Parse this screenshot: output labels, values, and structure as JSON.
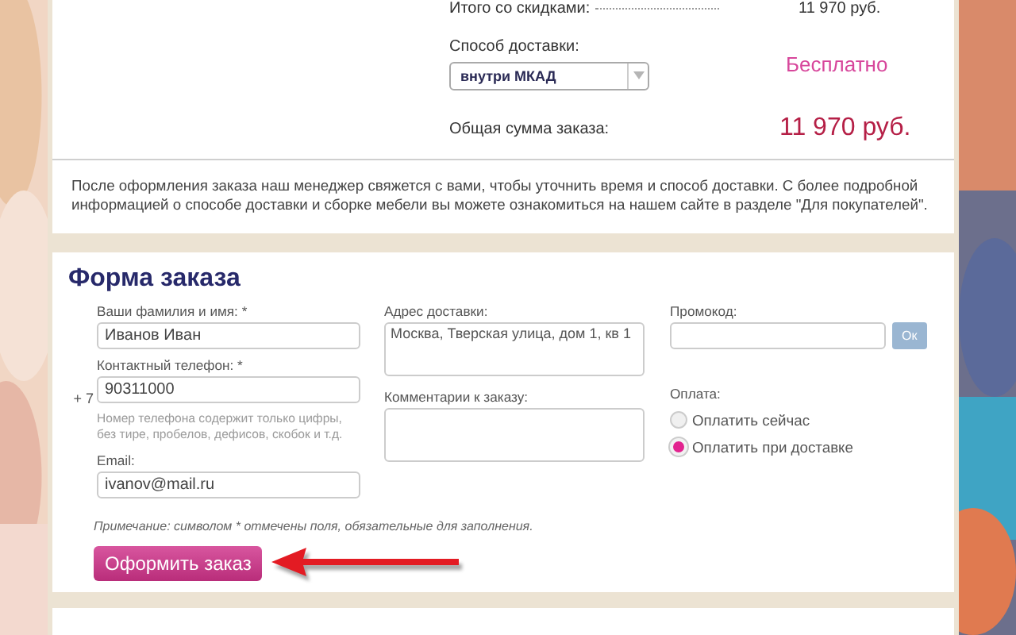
{
  "summary": {
    "discount_label": "Итого со скидками:",
    "discount_total": "11 970 руб.",
    "delivery_label": "Способ доставки:",
    "delivery_method": "внутри МКАД",
    "delivery_price": "Бесплатно",
    "total_label": "Общая сумма заказа:",
    "total": "11 970 руб."
  },
  "info": "После оформления заказа наш менеджер свяжется с вами, чтобы уточнить время и способ доставки. С более подробной информацией о способе доставки и сборке мебели вы можете ознакомиться на нашем сайте в разделе \"Для покупателей\".",
  "form": {
    "title": "Форма заказа",
    "name": {
      "label": "Ваши фамилия и имя: *",
      "value": "Иванов Иван"
    },
    "phone": {
      "label": "Контактный телефон: *",
      "prefix": "+ 7",
      "value": "90311000",
      "hint": "Номер телефона содержит только цифры, без тире, пробелов, дефисов, скобок и т.д."
    },
    "email": {
      "label": "Email:",
      "value": "ivanov@mail.ru"
    },
    "address": {
      "label": "Адрес доставки:",
      "value": "Москва, Тверская улица, дом 1, кв 1"
    },
    "comment": {
      "label": "Комментарии к заказу:"
    },
    "promo": {
      "label": "Промокод:",
      "button": "Ок"
    },
    "payment": {
      "label": "Оплата:",
      "options": [
        {
          "label": "Оплатить сейчас",
          "selected": false
        },
        {
          "label": "Оплатить при доставке",
          "selected": true
        }
      ]
    },
    "note": "Примечание: символом * отмечены поля, обязательные для заполнения.",
    "submit": "Оформить заказ"
  }
}
